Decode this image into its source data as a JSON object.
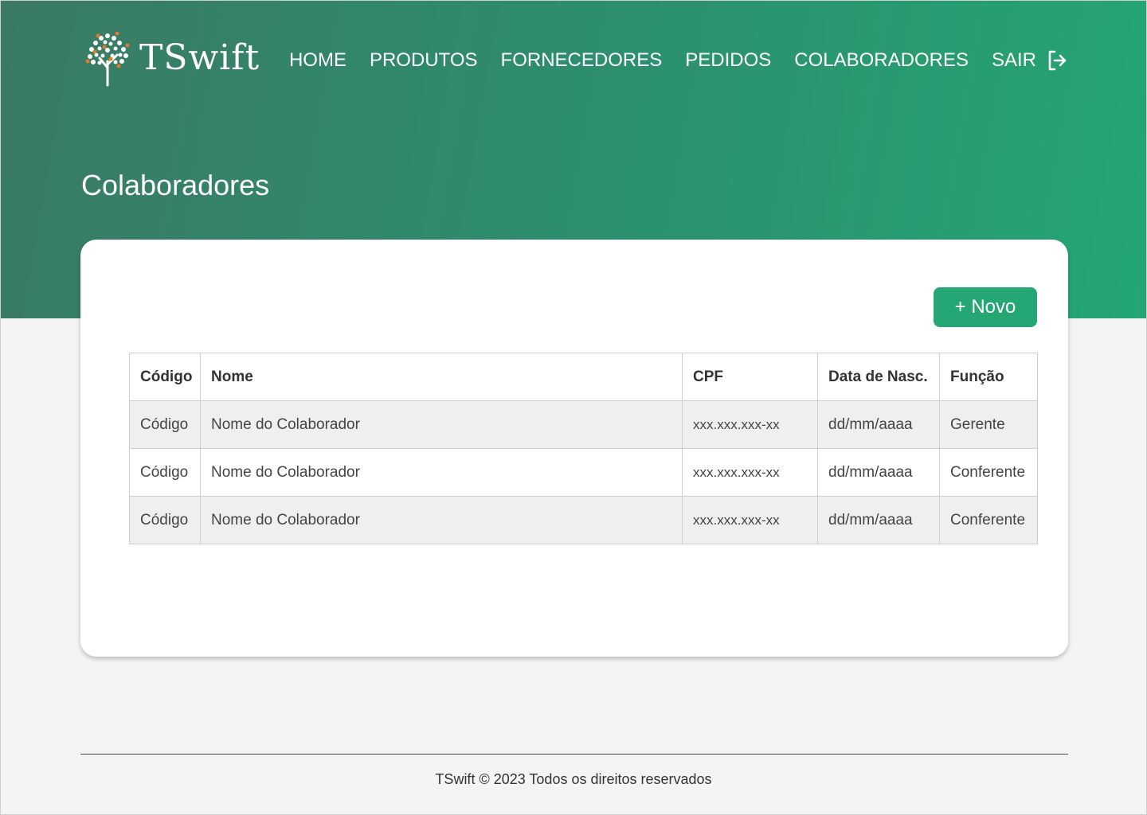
{
  "brand": {
    "name": "TSwift"
  },
  "nav": {
    "items": [
      "HOME",
      "PRODUTOS",
      "FORNECEDORES",
      "PEDIDOS",
      "COLABORADORES"
    ],
    "logout_label": "SAIR",
    "logout_icon": "logout-icon"
  },
  "page": {
    "title": "Colaboradores"
  },
  "actions": {
    "new_label": "+ Novo"
  },
  "table": {
    "headers": [
      "Código",
      "Nome",
      "CPF",
      "Data de Nasc.",
      "Função"
    ],
    "rows": [
      [
        "Código",
        "Nome do Colaborador",
        "xxx.xxx.xxx-xx",
        "dd/mm/aaaa",
        "Gerente"
      ],
      [
        "Código",
        "Nome do Colaborador",
        "xxx.xxx.xxx-xx",
        "dd/mm/aaaa",
        "Conferente"
      ],
      [
        "Código",
        "Nome do Colaborador",
        "xxx.xxx.xxx-xx",
        "dd/mm/aaaa",
        "Conferente"
      ]
    ]
  },
  "footer": {
    "text": "TSwift © 2023 Todos os direitos reservados"
  },
  "colors": {
    "header_gradient_start": "#3a7a64",
    "header_gradient_end": "#24a675",
    "accent": "#24a675",
    "page_background": "#f4f4f4",
    "striped_row": "#efefef"
  }
}
